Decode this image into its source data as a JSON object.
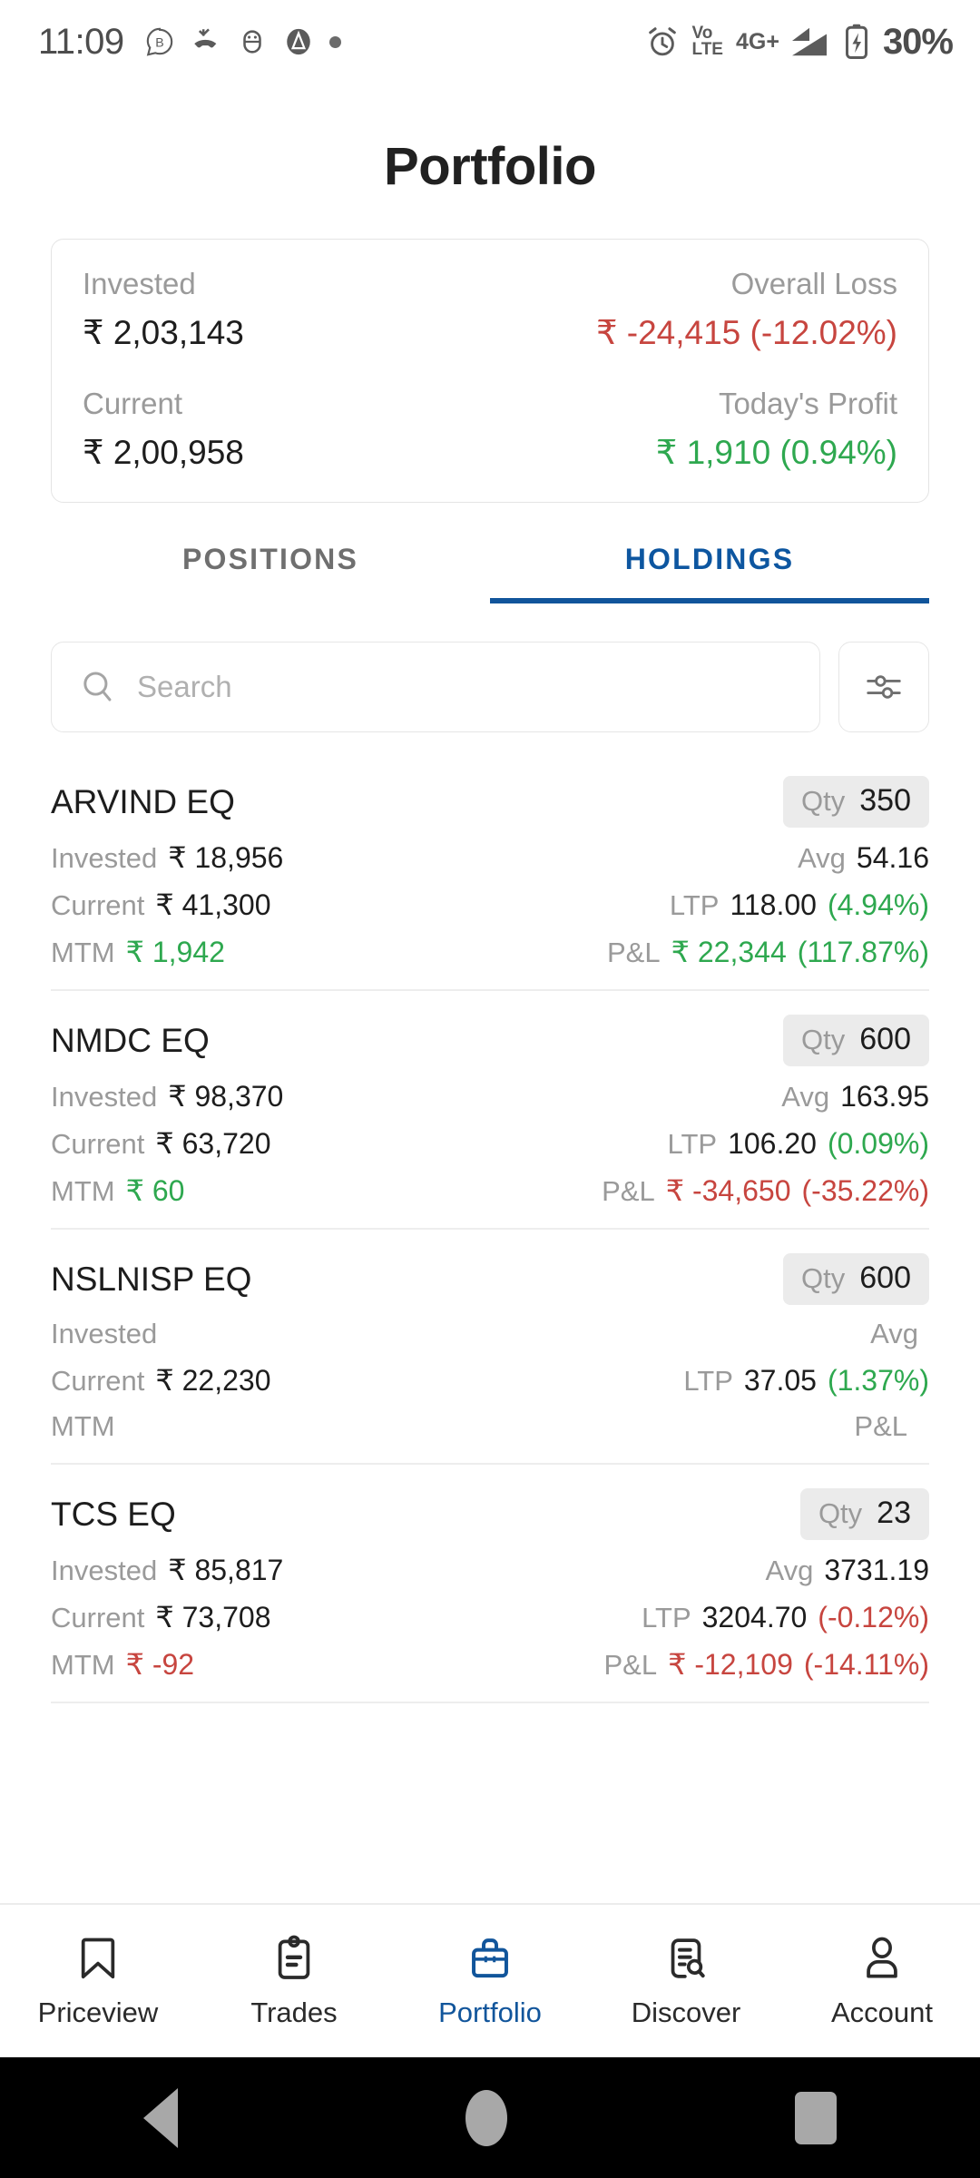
{
  "status_bar": {
    "time": "11:09",
    "left_icons": [
      "bluetooth-badge-icon",
      "missed-call-icon",
      "android-debug-icon",
      "app-a-icon",
      "dot-indicator-icon"
    ],
    "alarm_icon": "alarm-icon",
    "volte_line1": "Vo",
    "volte_line2": "LTE",
    "network_type": "4G+",
    "signal_icon": "signal-bars-icon",
    "battery_icon": "battery-charging-icon",
    "battery_percent": "30%"
  },
  "header": {
    "title": "Portfolio"
  },
  "summary": {
    "invested_label": "Invested",
    "invested_value": "₹ 2,03,143",
    "overall_label": "Overall Loss",
    "overall_value": "₹ -24,415 (-12.02%)",
    "current_label": "Current",
    "current_value": "₹ 2,00,958",
    "today_label": "Today's Profit",
    "today_value": "₹ 1,910 (0.94%)"
  },
  "tabs": [
    {
      "label": "POSITIONS",
      "active": false
    },
    {
      "label": "HOLDINGS",
      "active": true
    }
  ],
  "search": {
    "placeholder": "Search",
    "value": "",
    "icon": "search-icon",
    "filter_icon": "filter-sliders-icon"
  },
  "labels": {
    "qty": "Qty",
    "invested": "Invested",
    "avg": "Avg",
    "current": "Current",
    "ltp": "LTP",
    "mtm": "MTM",
    "pnl": "P&L"
  },
  "holdings": [
    {
      "name": "ARVIND EQ",
      "qty": "350",
      "invested": "₹ 18,956",
      "avg": "54.16",
      "current": "₹ 41,300",
      "ltp": "118.00",
      "ltp_pct": "(4.94%)",
      "ltp_dir": "pos",
      "mtm": "₹ 1,942",
      "mtm_dir": "pos",
      "pnl": "₹ 22,344",
      "pnl_pct": "(117.87%)",
      "pnl_dir": "pos"
    },
    {
      "name": "NMDC EQ",
      "qty": "600",
      "invested": "₹ 98,370",
      "avg": "163.95",
      "current": "₹ 63,720",
      "ltp": "106.20",
      "ltp_pct": "(0.09%)",
      "ltp_dir": "pos",
      "mtm": "₹ 60",
      "mtm_dir": "pos",
      "pnl": "₹ -34,650",
      "pnl_pct": "(-35.22%)",
      "pnl_dir": "neg"
    },
    {
      "name": "NSLNISP EQ",
      "qty": "600",
      "invested": "",
      "avg": "",
      "current": "₹ 22,230",
      "ltp": "37.05",
      "ltp_pct": "(1.37%)",
      "ltp_dir": "pos",
      "mtm": "",
      "mtm_dir": "pos",
      "pnl": "",
      "pnl_pct": "",
      "pnl_dir": "pos"
    },
    {
      "name": "TCS EQ",
      "qty": "23",
      "invested": "₹ 85,817",
      "avg": "3731.19",
      "current": "₹ 73,708",
      "ltp": "3204.70",
      "ltp_pct": "(-0.12%)",
      "ltp_dir": "neg",
      "mtm": "₹ -92",
      "mtm_dir": "neg",
      "pnl": "₹ -12,109",
      "pnl_pct": "(-14.11%)",
      "pnl_dir": "neg"
    }
  ],
  "bottom_nav": [
    {
      "label": "Priceview",
      "icon": "bookmark-icon",
      "active": false
    },
    {
      "label": "Trades",
      "icon": "clipboard-icon",
      "active": false
    },
    {
      "label": "Portfolio",
      "icon": "briefcase-icon",
      "active": true
    },
    {
      "label": "Discover",
      "icon": "document-search-icon",
      "active": false
    },
    {
      "label": "Account",
      "icon": "person-icon",
      "active": false
    }
  ],
  "android_nav": {
    "back": "back-triangle-icon",
    "home": "home-circle-icon",
    "recents": "recents-square-icon"
  },
  "colors": {
    "accent_blue": "#11559b",
    "positive_green": "#2ea84f",
    "negative_red": "#c7453f",
    "label_gray": "#9a9a9a",
    "badge_gray": "#ebebeb"
  }
}
